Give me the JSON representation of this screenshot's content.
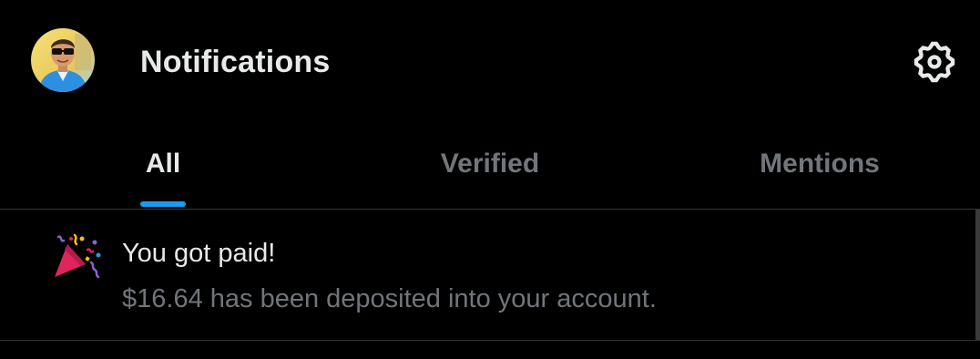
{
  "header": {
    "title": "Notifications",
    "avatar_icon": "user-avatar",
    "settings_icon": "gear-icon"
  },
  "tabs": [
    {
      "label": "All",
      "selected": true
    },
    {
      "label": "Verified",
      "selected": false
    },
    {
      "label": "Mentions",
      "selected": false
    }
  ],
  "notifications": [
    {
      "icon": "party-popper-icon",
      "title": "You got paid!",
      "body": "$16.64 has been deposited into your account."
    }
  ],
  "colors": {
    "background": "#000000",
    "text_primary": "#e7e9ea",
    "text_secondary": "#71767b",
    "accent": "#1d9bf0",
    "divider": "#2f3336"
  }
}
